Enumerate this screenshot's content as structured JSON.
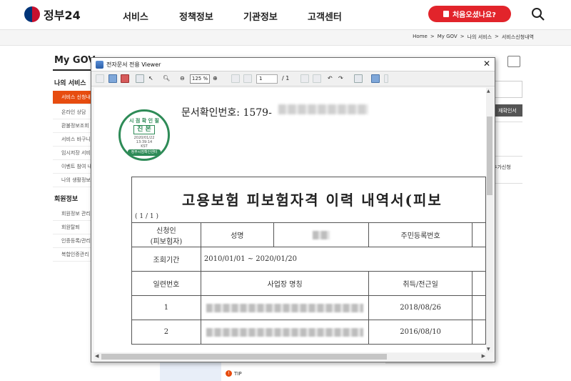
{
  "header": {
    "logo_text": "정부24",
    "nav": [
      "서비스",
      "정책정보",
      "기관정보",
      "고객센터"
    ],
    "first_visit_button": "처음오셨나요?"
  },
  "breadcrumb": [
    "Home",
    ">",
    "My GOV",
    ">",
    "나의 서비스",
    ">",
    "서비스신청내역"
  ],
  "sidebar": {
    "title": "My GOV",
    "section1": "나의 서비스",
    "items1": [
      "서비스 신청내",
      "온라인 상담",
      "환불정보조회",
      "서비스 바구니",
      "임시저장 서비",
      "이벤트 참여 내",
      "나의 생활정보"
    ],
    "section2": "회원정보",
    "items2": [
      "회원정보 관리",
      "회원탈퇴",
      "인증등록/관리",
      "복합인증관리"
    ]
  },
  "right_panel": {
    "cert_button": "재확인서",
    "add_button": "추가신청",
    "tip": "TIP"
  },
  "viewer": {
    "title": "전자문서 전용 Viewer",
    "close": "✕",
    "zoom": "125 %",
    "page_current": "1",
    "page_total": "/ 1",
    "doc_number_label": "문서확인번호: 1579-",
    "stamp": {
      "top": "시 점 확 인 필",
      "main": "진 본",
      "date": "2020/01/22",
      "time": "13:39:14",
      "zone": "KST",
      "bottom": "정부시점확인센터"
    },
    "doc": {
      "title": "고용보험 피보험자격 이력 내역서(피보",
      "page": "( 1 / 1 )",
      "applicant_label": "신청인",
      "applicant_sub": "(피보험자)",
      "name_label": "성명",
      "rrn_label": "주민등록번호",
      "period_label": "조회기간",
      "period_value": "2010/01/01 ~ 2020/01/20",
      "col_no": "일련번호",
      "col_company": "사업장 명칭",
      "col_date": "취득/전근일",
      "rows": [
        {
          "no": "1",
          "date": "2018/08/26"
        },
        {
          "no": "2",
          "date": "2016/08/10"
        }
      ]
    }
  }
}
